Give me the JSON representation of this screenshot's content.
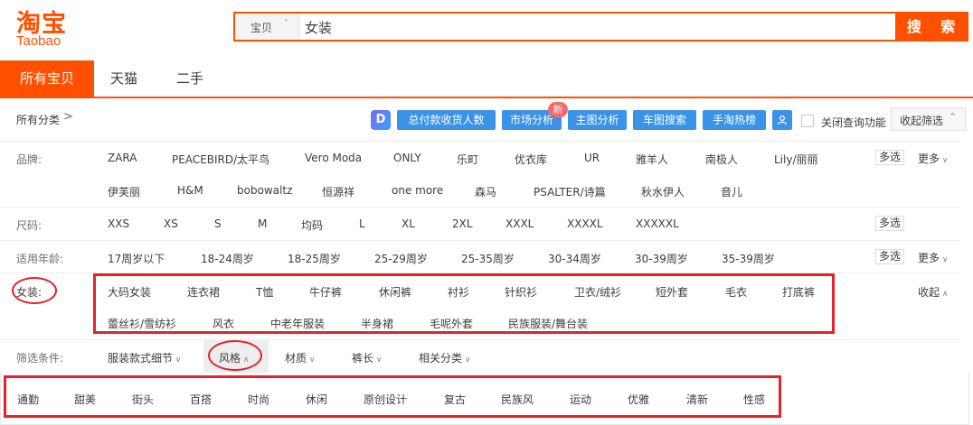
{
  "header": {
    "logo_cn": "淘宝",
    "logo_en": "Taobao",
    "search": {
      "type_label": "宝贝",
      "type_arrow": "˅",
      "query": "女装",
      "button": "搜 索"
    }
  },
  "tabs": [
    {
      "label": "所有宝贝",
      "active": true
    },
    {
      "label": "天猫",
      "active": false
    },
    {
      "label": "二手",
      "active": false
    }
  ],
  "toolbar": {
    "all_categories": "所有分类",
    "arrow": ">",
    "logo_letter": "D",
    "buttons": [
      "总付款收货人数",
      "市场分析",
      "主图分析",
      "车图搜索",
      "手淘热榜"
    ],
    "user_icon": "user-icon",
    "new_badge": "新",
    "close_query_label": "关闭查询功能",
    "collapse_filter": "收起筛选",
    "collapse_arrow": "⌃"
  },
  "filters": {
    "brand": {
      "label": "品牌:",
      "row1": [
        "ZARA",
        "PEACEBIRD/太平鸟",
        "Vero Moda",
        "ONLY",
        "乐町",
        "优衣库",
        "UR",
        "雅羊人",
        "南极人",
        "Lily/丽丽"
      ],
      "row2": [
        "伊芙丽",
        "H&M",
        "bobowaltz",
        "恒源祥",
        "one more",
        "森马",
        "PSALTER/诗篇",
        "秋水伊人",
        "音儿"
      ],
      "multi": "多选",
      "more": "更多"
    },
    "size": {
      "label": "尺码:",
      "options": [
        "XXS",
        "XS",
        "S",
        "M",
        "均码",
        "L",
        "XL",
        "2XL",
        "XXXL",
        "XXXXL",
        "XXXXXL"
      ],
      "multi": "多选"
    },
    "age": {
      "label": "适用年龄:",
      "options": [
        "17周岁以下",
        "18-24周岁",
        "18-25周岁",
        "25-29周岁",
        "25-35周岁",
        "30-34周岁",
        "30-39周岁",
        "35-39周岁"
      ],
      "multi": "多选",
      "more": "更多"
    },
    "womens": {
      "label": "女装:",
      "row1": [
        "大码女装",
        "连衣裙",
        "T恤",
        "牛仔裤",
        "休闲裤",
        "衬衫",
        "针织衫",
        "卫衣/绒衫",
        "短外套",
        "毛衣",
        "打底裤"
      ],
      "row2": [
        "蕾丝衫/雪纺衫",
        "风衣",
        "中老年服装",
        "半身裙",
        "毛呢外套",
        "民族服装/舞台装"
      ],
      "collapse": "收起"
    },
    "conditions": {
      "label": "筛选条件:",
      "options": [
        "服装款式细节",
        "风格",
        "材质",
        "裤长",
        "相关分类"
      ]
    },
    "style_values": [
      "通勤",
      "甜美",
      "街头",
      "百搭",
      "时尚",
      "休闲",
      "原创设计",
      "复古",
      "民族风",
      "运动",
      "优雅",
      "清新",
      "性感"
    ]
  },
  "colors": {
    "brand": "#ff5000",
    "tool_blue": "#3a93e6",
    "annotation_red": "#e8202a"
  }
}
